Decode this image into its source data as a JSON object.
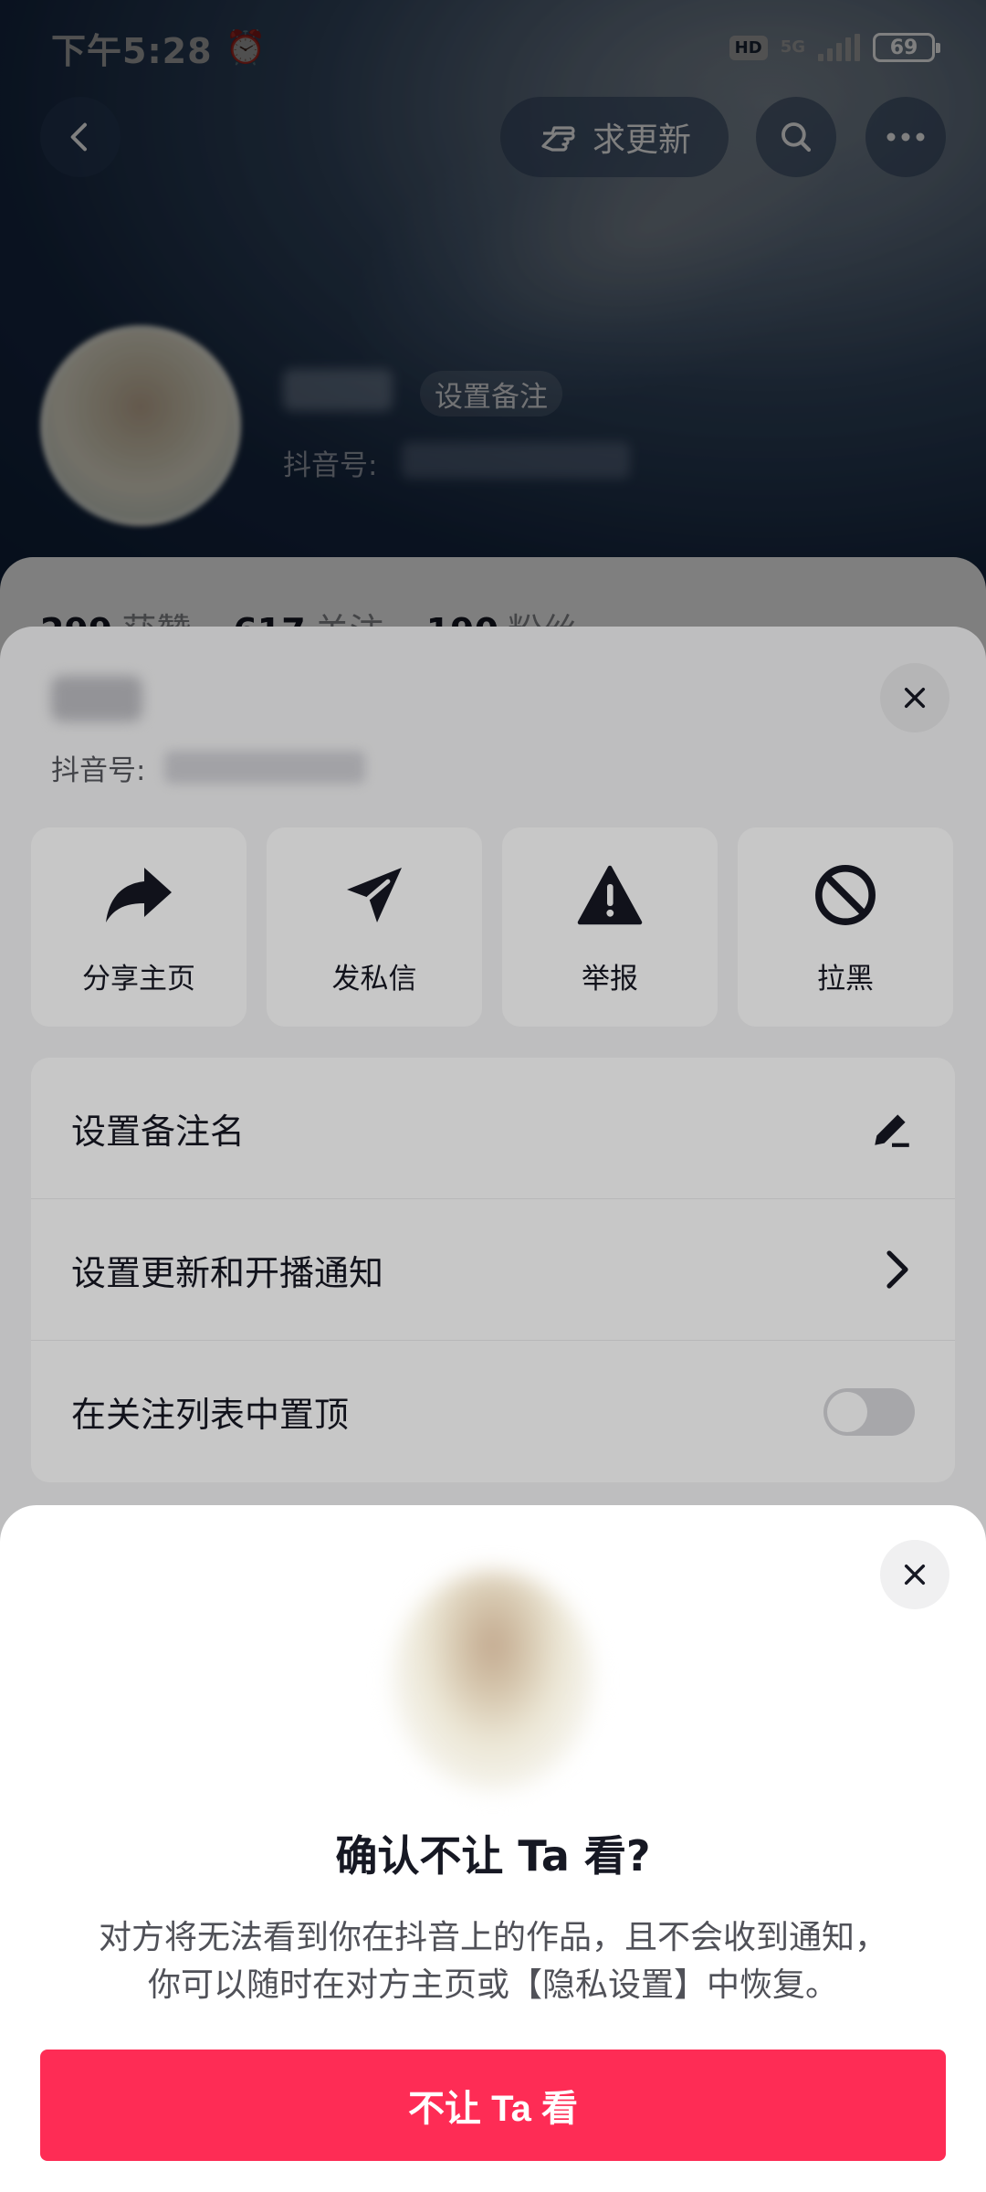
{
  "status_bar": {
    "time": "下午5:28",
    "network": "5G",
    "hd": "HD",
    "battery": "69"
  },
  "header": {
    "request_update_label": "求更新",
    "set_note_chip": "设置备注",
    "douyin_id_label": "抖音号:"
  },
  "stats": [
    {
      "value": "299",
      "label": "获赞"
    },
    {
      "value": "617",
      "label": "关注"
    },
    {
      "value": "190",
      "label": "粉丝"
    }
  ],
  "action_sheet": {
    "douyin_id_label": "抖音号:",
    "tiles": [
      {
        "label": "分享主页",
        "icon": "share-icon"
      },
      {
        "label": "发私信",
        "icon": "send-message-icon"
      },
      {
        "label": "举报",
        "icon": "report-warning-icon"
      },
      {
        "label": "拉黑",
        "icon": "block-icon"
      }
    ],
    "menu": [
      {
        "label": "设置备注名",
        "control": "edit-pencil-icon"
      },
      {
        "label": "设置更新和开播通知",
        "control": "chevron-right-icon"
      },
      {
        "label": "在关注列表中置顶",
        "control": "toggle-switch",
        "toggle_on": false
      }
    ]
  },
  "dialog": {
    "title": "确认不让 Ta 看?",
    "description_line1": "对方将无法看到你在抖音上的作品，且不会收到通知，",
    "description_line2": "你可以随时在对方主页或【隐私设置】中恢复。",
    "confirm_button": "不让 Ta 看"
  },
  "colors": {
    "primary": "#fe2c55",
    "text": "#161823",
    "secondary_text": "#505158"
  }
}
